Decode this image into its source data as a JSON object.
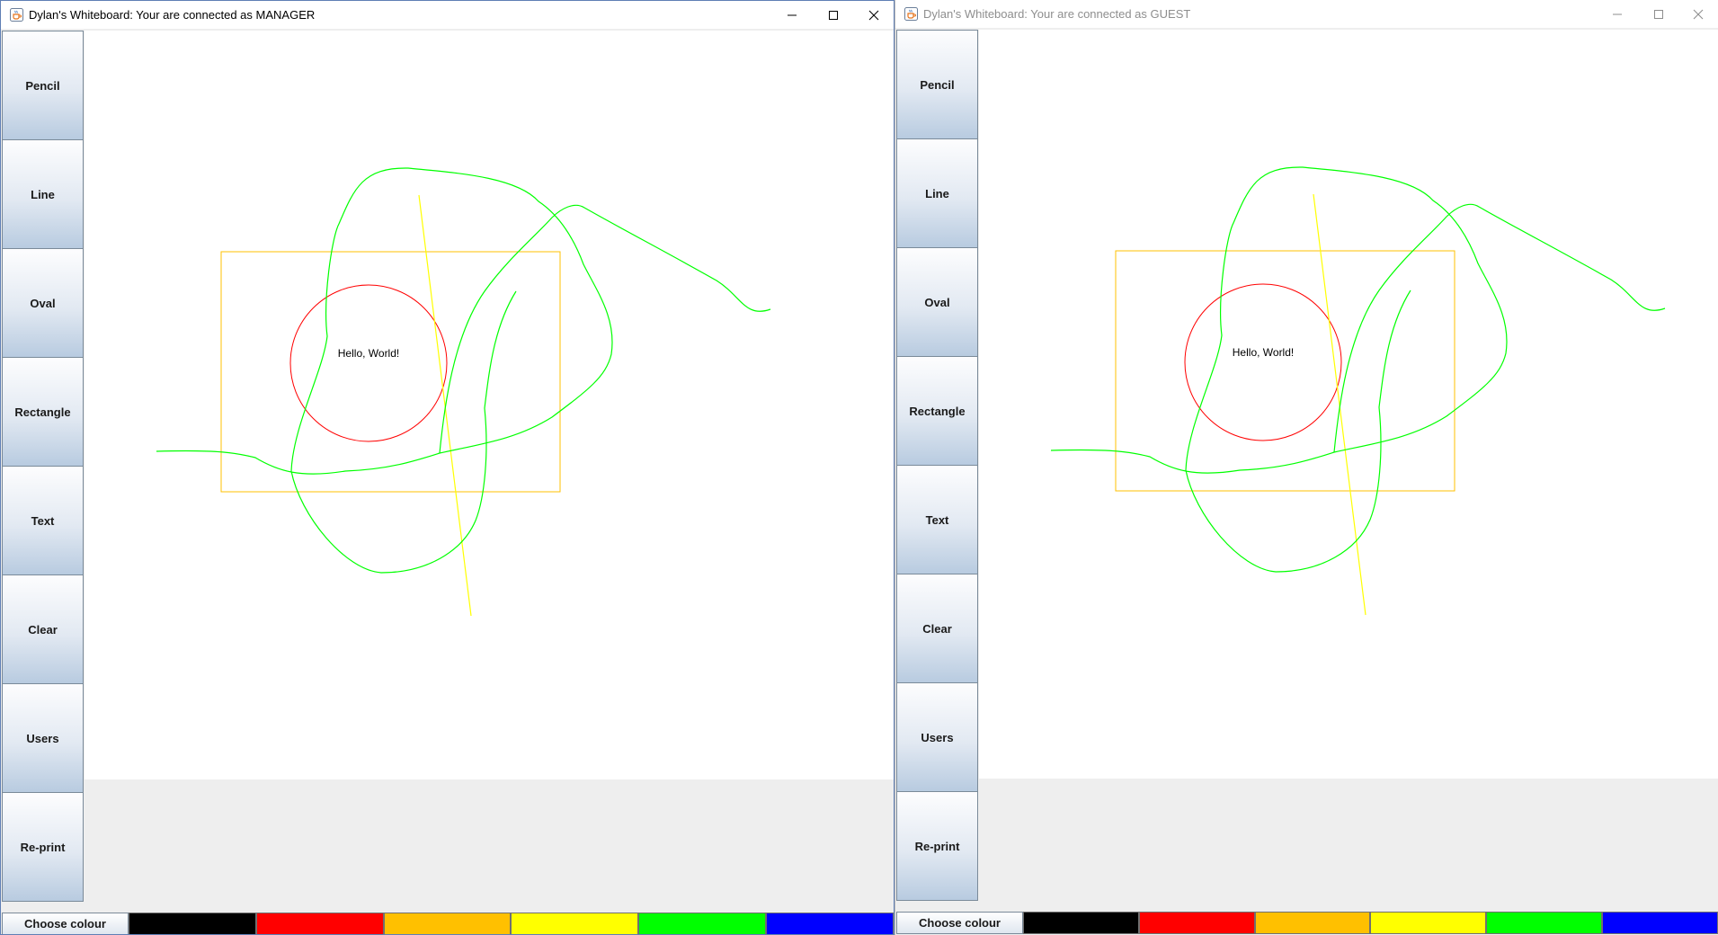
{
  "manager": {
    "title": "Dylan's Whiteboard: Your are connected as MANAGER",
    "text_label": "Hello, World!"
  },
  "guest": {
    "title": "Dylan's Whiteboard: Your are connected as GUEST",
    "text_label": "Hello, World!"
  },
  "tools": [
    "Pencil",
    "Line",
    "Oval",
    "Rectangle",
    "Text",
    "Clear",
    "Users",
    "Re-print"
  ],
  "choose_colour_label": "Choose colour",
  "palette": [
    "#000000",
    "#ff0000",
    "#ffc000",
    "#ffff00",
    "#00ff00",
    "#0000ff"
  ],
  "shape_colors": {
    "pencil": "#00ff00",
    "line": "#ffff00",
    "oval": "#ff0000",
    "rectangle": "#ffc000"
  },
  "icons": {
    "app": "java-cup-icon",
    "minimize": "minimize-icon",
    "maximize": "maximize-icon",
    "close": "close-icon"
  }
}
